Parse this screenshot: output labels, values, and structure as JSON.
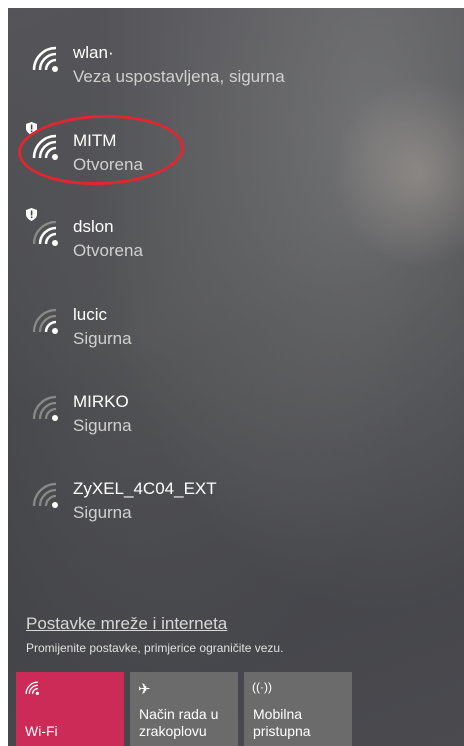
{
  "networks": [
    {
      "name": "wlan·",
      "status": "Veza uspostavljena, sigurna"
    },
    {
      "name": "MITM",
      "status": "Otvorena"
    },
    {
      "name": "dslon",
      "status": "Otvorena"
    },
    {
      "name": "lucic",
      "status": "Sigurna"
    },
    {
      "name": "MIRKO",
      "status": "Sigurna"
    },
    {
      "name": "ZyXEL_4C04_EXT",
      "status": "Sigurna"
    }
  ],
  "settings": {
    "link": "Postavke mreže i interneta",
    "description": "Promijenite postavke, primjerice ograničite vezu."
  },
  "quick_actions": {
    "wifi": {
      "label": "Wi-Fi",
      "icon": "wifi-icon"
    },
    "airplane": {
      "label_line1": "Način rada u",
      "label_line2": "zrakoplovu",
      "icon": "airplane-icon"
    },
    "mobile": {
      "label_line1": "Mobilna",
      "label_line2": "pristupna",
      "icon": "mobile-hotspot-icon"
    }
  },
  "colors": {
    "annotation_circle": "#e0262f",
    "wifi_tile_active": "#cc2b58"
  }
}
